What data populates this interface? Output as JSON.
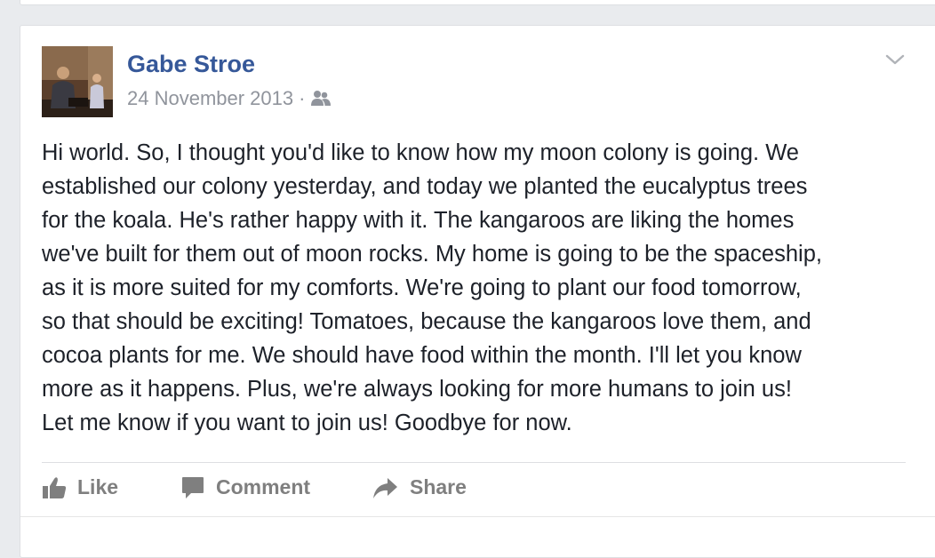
{
  "post": {
    "author_name": "Gabe Stroe",
    "date": "24 November 2013",
    "separator": "·",
    "audience_icon": "friends-icon",
    "options_icon": "chevron-down-icon",
    "text": "Hi world. So, I thought you'd like to know how my moon colony is going. We\nestablished our colony yesterday, and today we planted the eucalyptus trees\nfor the koala. He's rather happy with it. The kangaroos are liking the homes\nwe've built for them out of moon rocks. My home is going to be the spaceship,\nas it is more suited for my comforts. We're going to plant our food tomorrow,\nso that should be exciting! Tomatoes, because the kangaroos love them, and\ncocoa plants for me. We should have food within the month. I'll let you know\nmore as it happens. Plus, we're always looking for more humans to join us!\nLet me know if you want to join us! Goodbye for now."
  },
  "actions": {
    "like_label": "Like",
    "comment_label": "Comment",
    "share_label": "Share"
  },
  "colors": {
    "author_link": "#365899",
    "meta_text": "#90949c",
    "action_text": "#7f7f7f",
    "body_text": "#1d2129",
    "page_background": "#e9ebee"
  }
}
